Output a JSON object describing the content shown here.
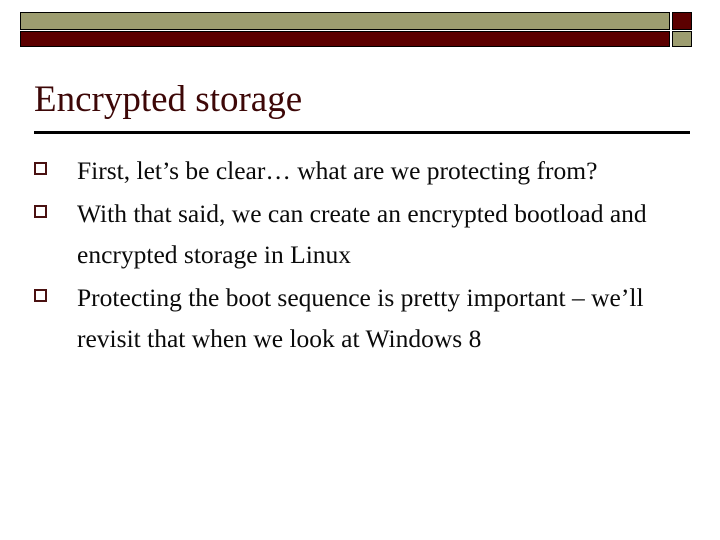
{
  "slide": {
    "header": {
      "bar_top_color": "#9d9d70",
      "bar_bottom_color": "#5c0000",
      "cap_top_color": "#5c0000",
      "cap_bottom_color": "#9d9d70",
      "outline_color": "#000000"
    },
    "title": "Encrypted storage",
    "title_color": "#3d0707",
    "rule_color": "#000000",
    "bullet_marker": "hollow-square",
    "bullet_marker_color": "#4a1111",
    "body_text_color": "#0a0a0a",
    "bullets": [
      "First, let’s be clear… what are we protecting from?",
      "With that said, we can create an encrypted bootload and encrypted storage in Linux",
      "Protecting the boot sequence is pretty important – we’ll revisit that when we look at Windows 8"
    ]
  }
}
